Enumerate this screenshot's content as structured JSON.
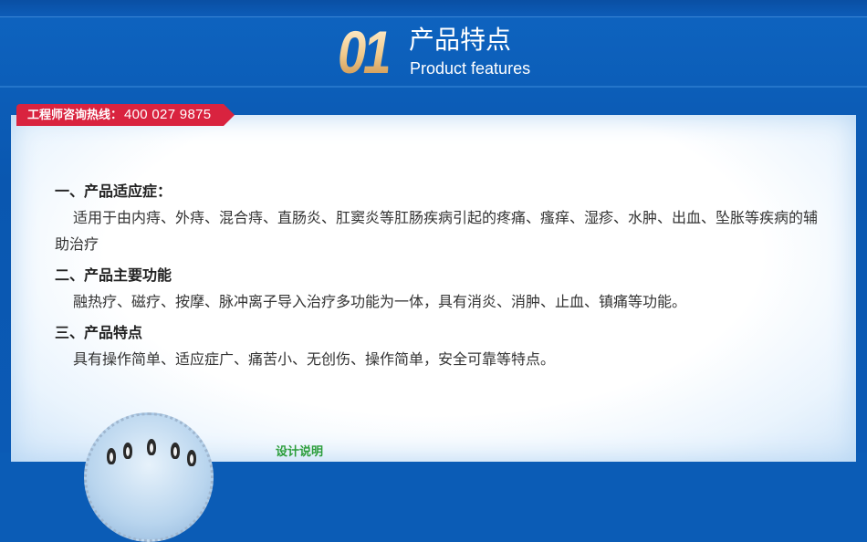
{
  "header": {
    "number": "01",
    "title_cn": "产品特点",
    "title_en": "Product features"
  },
  "hotline": {
    "label": "工程师咨询热线：",
    "phone": "400 027 9875"
  },
  "sections": [
    {
      "title": "一、产品适应症：",
      "body": "适用于由内痔、外痔、混合痔、直肠炎、肛窦炎等肛肠疾病引起的疼痛、瘙痒、湿疹、水肿、出血、坠胀等疾病的辅助治疗"
    },
    {
      "title": "二、产品主要功能",
      "body": "融热疗、磁疗、按摩、脉冲离子导入治疗多功能为一体，具有消炎、消肿、止血、镇痛等功能。"
    },
    {
      "title": "三、产品特点",
      "body": "具有操作简单、适应症广、痛苦小、无创伤、操作简单，安全可靠等特点。"
    }
  ],
  "footer": {
    "design_note": "设计说明"
  },
  "colors": {
    "background": "#0b5cb6",
    "hotline_bg": "#d9233f",
    "note_green": "#2a9d3a"
  }
}
